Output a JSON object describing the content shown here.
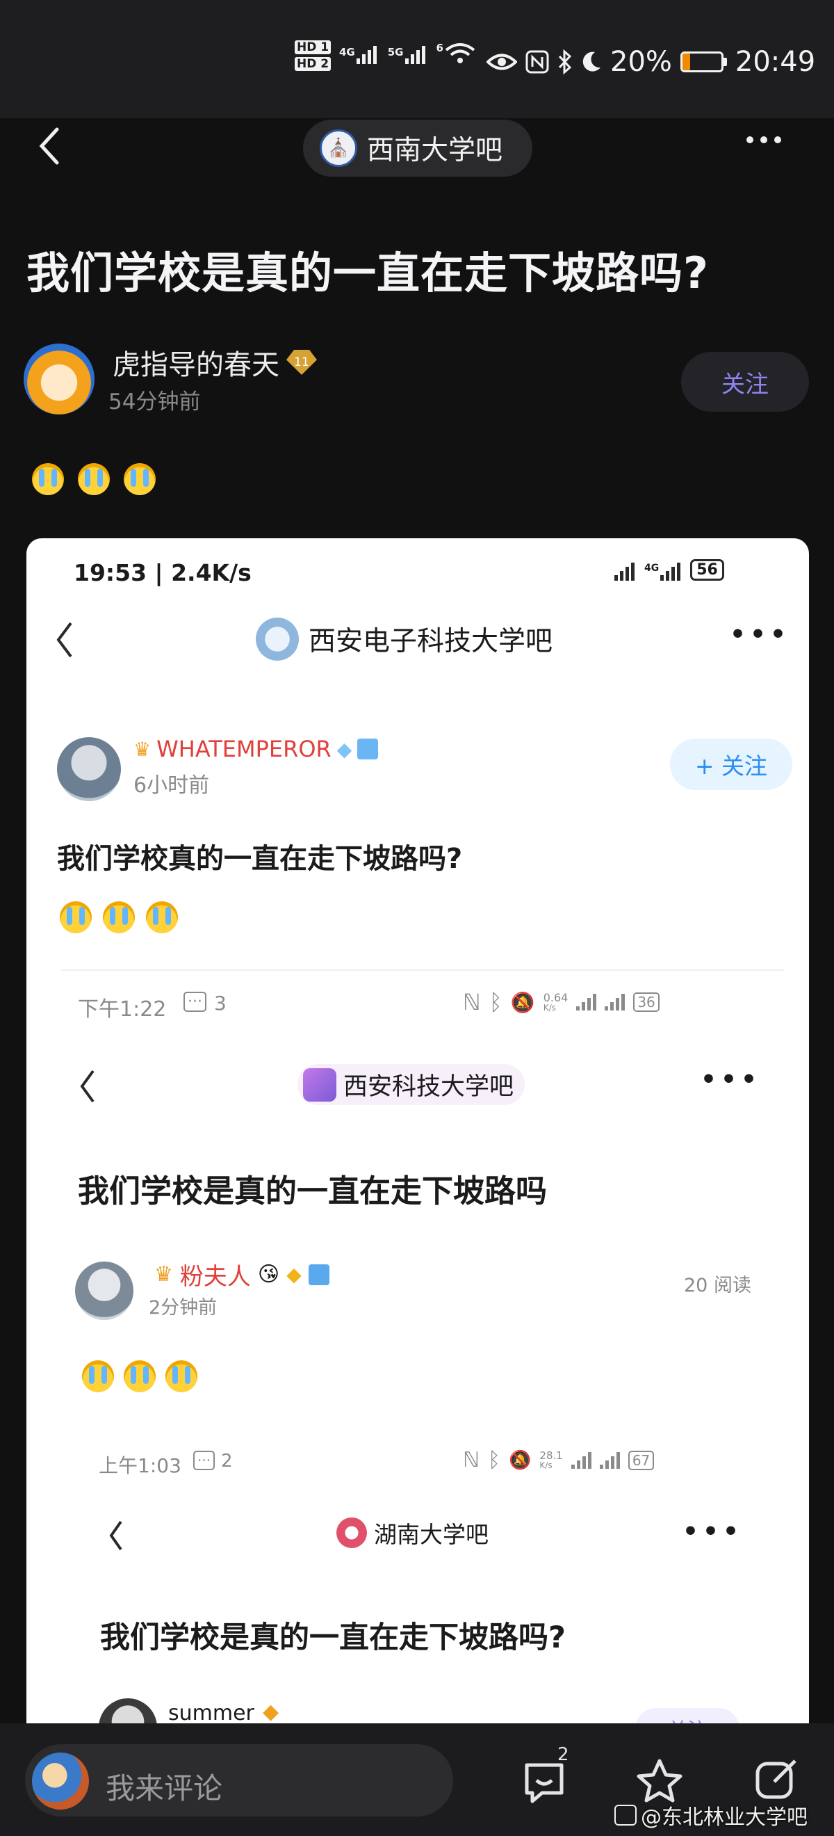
{
  "status_bar": {
    "hd1": "HD 1",
    "hd2": "HD 2",
    "net1": "4G",
    "net2": "5G",
    "wifi_badge": "6",
    "battery": "20%",
    "battery_level": 0.2,
    "time": "20:49"
  },
  "nav": {
    "back_icon": "back-arrow-icon",
    "forum_name": "西南大学吧",
    "more_icon": "more-dots-icon"
  },
  "post": {
    "title": "我们学校是真的一直在走下坡路吗?",
    "author": "虎指导的春天",
    "level": "11",
    "time": "54分钟前",
    "follow_label": "关注",
    "emojis": [
      "crying-emoji",
      "crying-emoji",
      "crying-emoji"
    ]
  },
  "image": {
    "status": {
      "time": "19:53 | 2.4K/s",
      "net": "4G",
      "battery": "56"
    },
    "forum_name": "西安电子科技大学吧",
    "user": "WHATEMPEROR",
    "time": "6小时前",
    "follow_label": "+ 关注",
    "title": "我们学校真的一直在走下坡路吗?",
    "nested1": {
      "status_time": "下午1:22",
      "status_msgs": "3",
      "status_speed": "0.64",
      "status_speed_unit": "K/s",
      "battery": "36",
      "forum_name": "西安科技大学吧",
      "title": "我们学校是真的一直在走下坡路吗",
      "user": "粉夫人",
      "time": "2分钟前",
      "reads": "20 阅读"
    },
    "nested2": {
      "status_time": "上午1:03",
      "status_msgs": "2",
      "status_speed": "28.1",
      "status_speed_unit": "K/s",
      "battery": "67",
      "forum_name": "湖南大学吧",
      "title": "我们学校是真的一直在走下坡路吗?",
      "user": "summer",
      "follow_label": "关注"
    }
  },
  "bottom": {
    "comment_placeholder": "我来评论",
    "comment_count": "2",
    "watermark": "@东北林业大学吧"
  }
}
